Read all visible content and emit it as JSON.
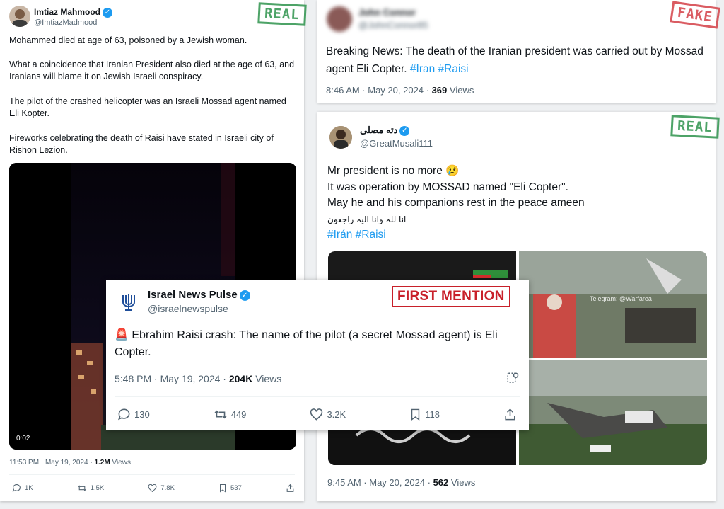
{
  "tweet1": {
    "name": "Imtiaz Mahmood",
    "handle": "@ImtiazMadmood",
    "stamp": "REAL",
    "paragraphs": [
      "Mohammed died at age of 63, poisoned by a Jewish woman.",
      "What a coincidence that Iranian President also died at the age of 63, and Iranians will blame it on Jewish Israeli conspiracy.",
      "The pilot of the crashed helicopter was an Israeli Mossad agent named Eli Kopter.",
      "Fireworks celebrating the death of Raisi have stated in Israeli city of Rishon Lezion."
    ],
    "video_time": "0:02",
    "timestamp": "11:53 PM · May 19, 2024 · ",
    "views_count": "1.2M",
    "views_label": " Views",
    "replies": "1K",
    "retweets": "1.5K",
    "likes": "7.8K",
    "bookmarks": "537"
  },
  "tweet2": {
    "name": "John Connor",
    "handle": "@JohnConnor85",
    "stamp": "FAKE",
    "text_main": "Breaking News: The death of the Iranian president was carried out by Mossad agent Eli Copter. ",
    "hashtags": "#Iran #Raisi",
    "timestamp": "8:46 AM · May 20, 2024 · ",
    "views_count": "369",
    "views_label": " Views"
  },
  "tweet3": {
    "name": "دته مصلی",
    "handle": "@GreatMusali111",
    "stamp": "REAL",
    "line1": "Mr president is no more 😢",
    "line2": "It was operation by MOSSAD named \"Eli Copter\".",
    "line3": "May he and his companions rest in the peace ameen",
    "line4": "انا للہ وانا الیہ راجعون",
    "hashtags": "#Irán #Raisi",
    "image_watermark": "Telegram: @Warfarea",
    "timestamp": "9:45 AM · May 20, 2024 · ",
    "views_count": "562",
    "views_label": " Views"
  },
  "tweet4": {
    "name": "Israel News Pulse",
    "handle": "@israelnewspulse",
    "stamp": "FIRST MENTION",
    "text": "🚨 Ebrahim Raisi crash: The name of the pilot (a secret Mossad agent) is Eli Copter.",
    "timestamp": "5:48 PM · May 19, 2024 · ",
    "views_count": "204K",
    "views_label": " Views",
    "replies": "130",
    "retweets": "449",
    "likes": "3.2K",
    "bookmarks": "118"
  },
  "colors": {
    "real": "#3a9a57",
    "fake": "#d64b52",
    "link": "#1d9bf0",
    "first_mention": "#c8202a"
  },
  "icons": [
    "verified-badge-icon",
    "reply-icon",
    "retweet-icon",
    "like-icon",
    "bookmark-icon",
    "share-icon",
    "grok-icon"
  ]
}
